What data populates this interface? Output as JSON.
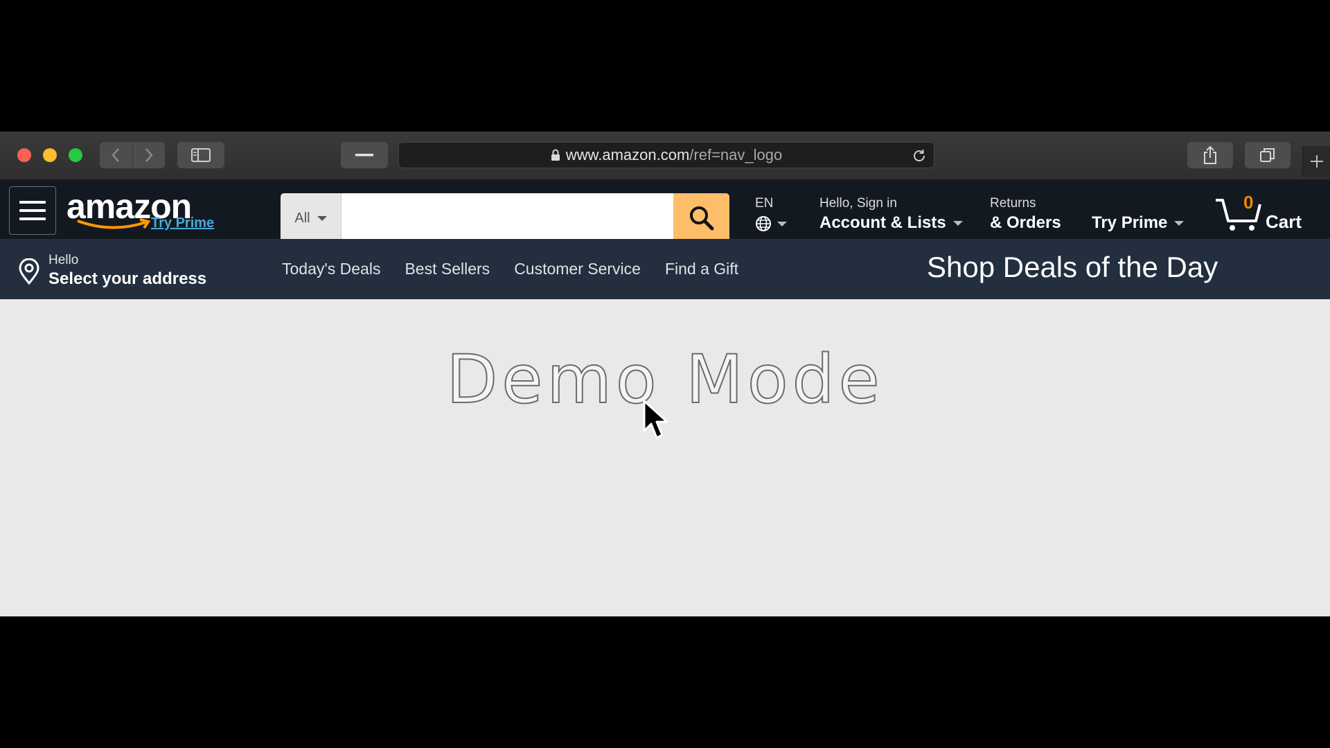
{
  "browser": {
    "url_host": "www.amazon.com",
    "url_path": "/ref=nav_logo"
  },
  "header": {
    "logo_text": "amazon",
    "logo_sub": "Try Prime",
    "search": {
      "department": "All",
      "placeholder": "",
      "value": ""
    },
    "language": "EN",
    "account": {
      "line1": "Hello, Sign in",
      "line2": "Account & Lists"
    },
    "orders": {
      "line1": "Returns",
      "line2": "& Orders"
    },
    "prime": "Try Prime",
    "cart": {
      "count": "0",
      "label": "Cart"
    }
  },
  "subnav": {
    "address": {
      "line1": "Hello",
      "line2": "Select your address"
    },
    "links": [
      "Today's Deals",
      "Best Sellers",
      "Customer Service",
      "Find a Gift"
    ],
    "promo": "Shop Deals of the Day"
  },
  "main": {
    "watermark": "Demo Mode"
  },
  "colors": {
    "header_bg": "#131921",
    "subnav_bg": "#232f3e",
    "search_button": "#febd69",
    "cart_count": "#f08804",
    "prime_link": "#4aa8d8"
  }
}
